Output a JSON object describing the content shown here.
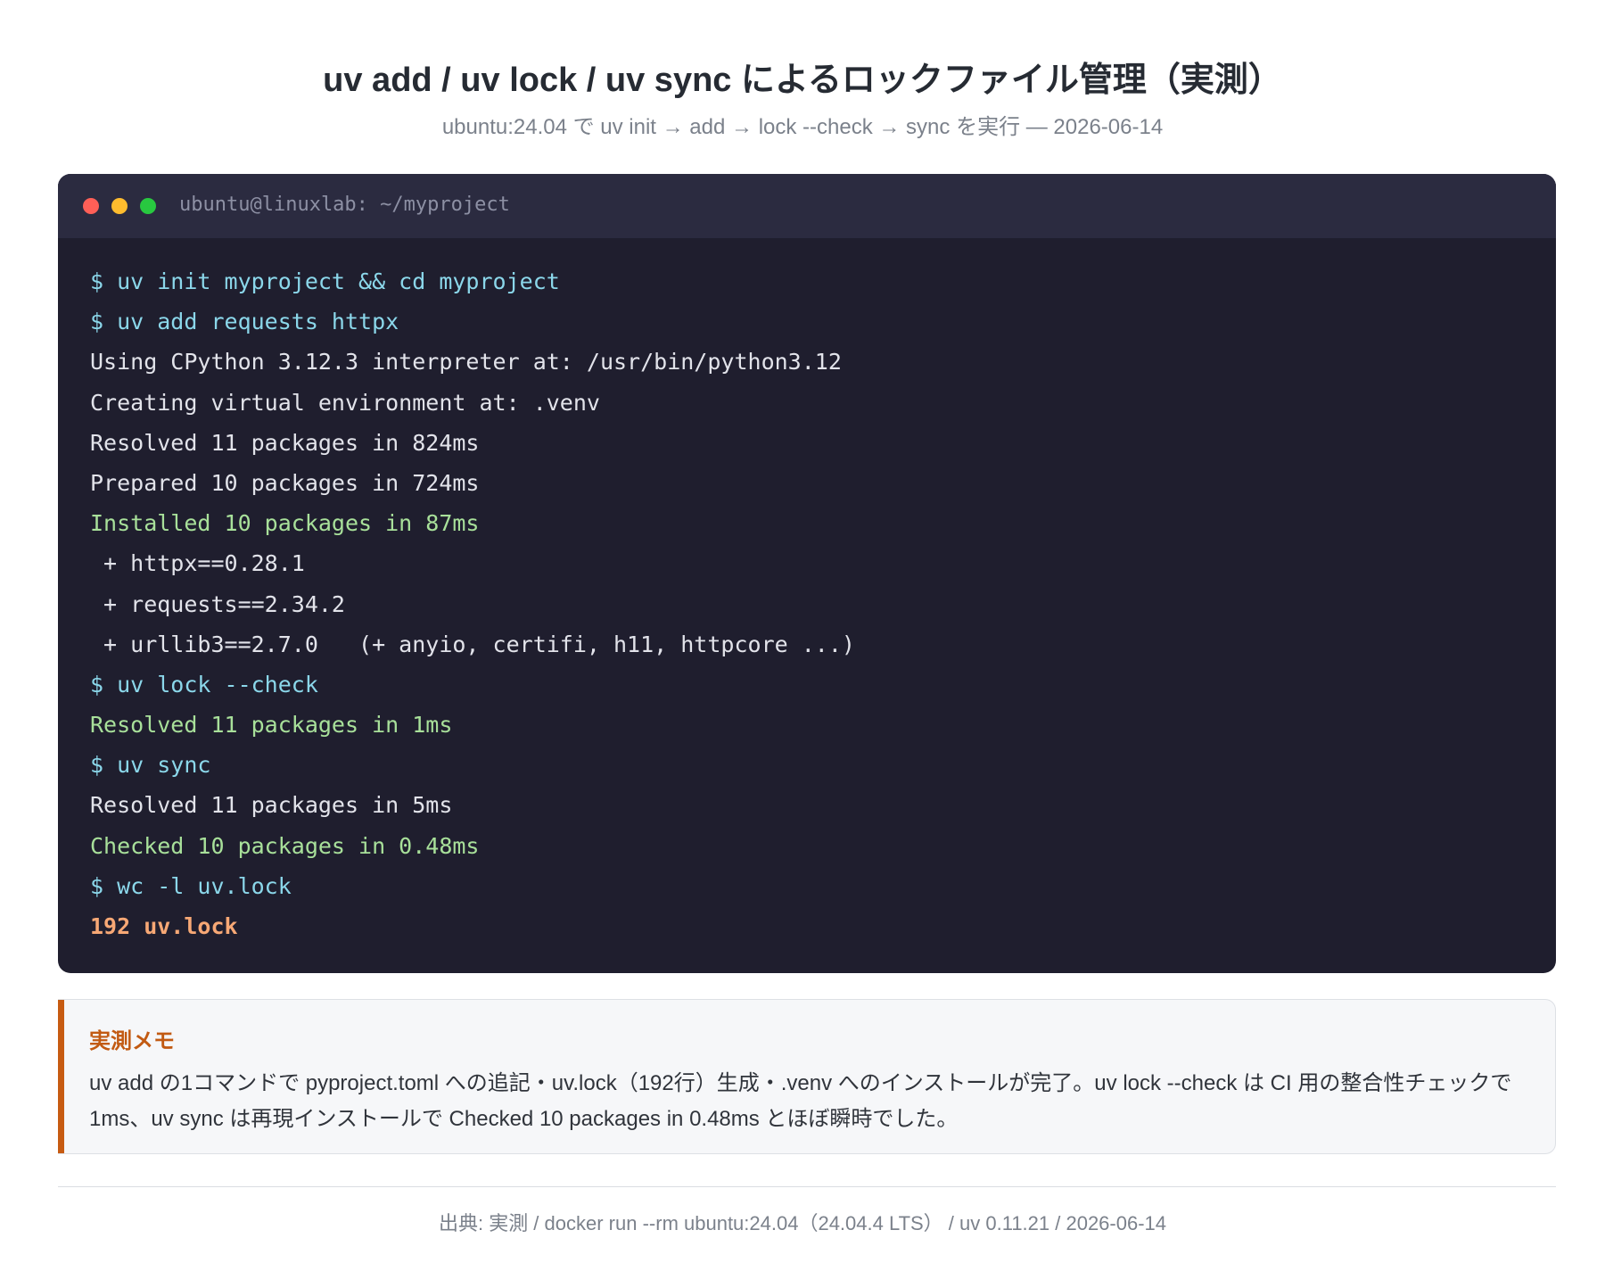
{
  "header": {
    "title": "uv add / uv lock / uv sync によるロックファイル管理（実測）",
    "subtitle": "ubuntu:24.04 で uv init → add → lock --check → sync を実行 — 2026-06-14"
  },
  "terminal": {
    "window_title": "ubuntu@linuxlab: ~/myproject",
    "lines": [
      {
        "text": "$ uv init myproject && cd myproject",
        "kind": "cmd"
      },
      {
        "text": "$ uv add requests httpx",
        "kind": "cmd"
      },
      {
        "text": "Using CPython 3.12.3 interpreter at: /usr/bin/python3.12",
        "kind": "out"
      },
      {
        "text": "Creating virtual environment at: .venv",
        "kind": "out"
      },
      {
        "text": "Resolved 11 packages in 824ms",
        "kind": "out"
      },
      {
        "text": "Prepared 10 packages in 724ms",
        "kind": "out"
      },
      {
        "text": "Installed 10 packages in 87ms",
        "kind": "ok"
      },
      {
        "text": " + httpx==0.28.1",
        "kind": "out"
      },
      {
        "text": " + requests==2.34.2",
        "kind": "out"
      },
      {
        "text": " + urllib3==2.7.0   (+ anyio, certifi, h11, httpcore ...)",
        "kind": "out"
      },
      {
        "text": "$ uv lock --check",
        "kind": "cmd"
      },
      {
        "text": "Resolved 11 packages in 1ms",
        "kind": "ok"
      },
      {
        "text": "$ uv sync",
        "kind": "cmd"
      },
      {
        "text": "Resolved 11 packages in 5ms",
        "kind": "out"
      },
      {
        "text": "Checked 10 packages in 0.48ms",
        "kind": "ok"
      },
      {
        "text": "$ wc -l uv.lock",
        "kind": "cmd"
      },
      {
        "text": "192 uv.lock",
        "kind": "hl"
      }
    ]
  },
  "memo": {
    "title": "実測メモ",
    "text": "uv add の1コマンドで pyproject.toml への追記・uv.lock（192行）生成・.venv へのインストールが完了。uv lock --check は CI 用の整合性チェックで 1ms、uv sync は再現インストールで Checked 10 packages in 0.48ms とほぼ瞬時でした。"
  },
  "footer": {
    "text": "出典: 実測 / docker run --rm ubuntu:24.04（24.04.4 LTS） / uv 0.11.21 / 2026-06-14"
  },
  "colors": {
    "terminal_bg": "#1f1e2e",
    "terminal_bar": "#2b2b40",
    "command": "#8bd7ea",
    "success": "#a8e09a",
    "highlight": "#f7a875",
    "accent": "#c75b12"
  }
}
